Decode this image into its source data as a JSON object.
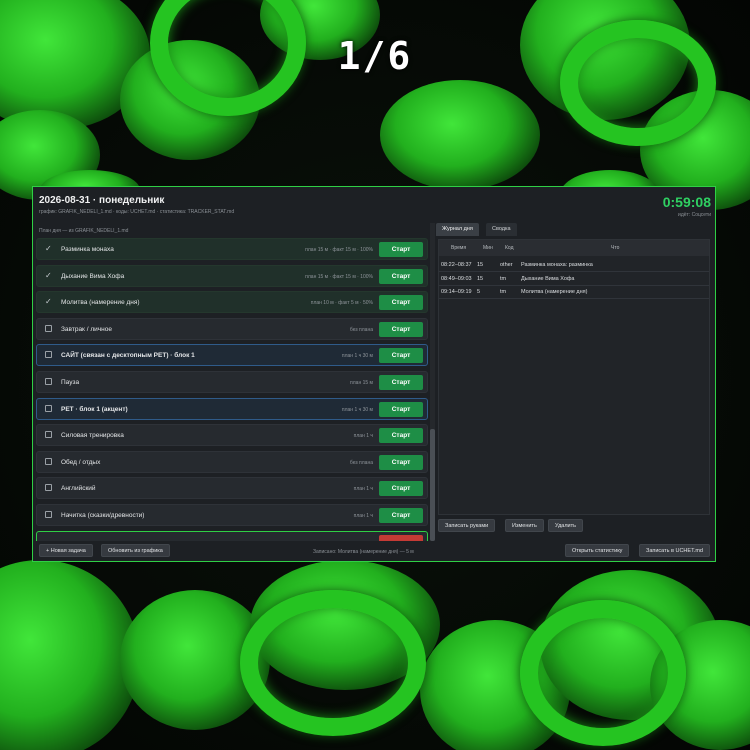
{
  "counter": "1/6",
  "header": {
    "title": "2026-08-31 · понедельник",
    "subtitle": "график: GRAFIK_NEDELI_1.md · коды: UCHET.md · статистика: TRACKER_STAT.md",
    "timer": "0:59:08",
    "timer_sub": "идёт: Соцсети"
  },
  "plan_header": "План дня — из GRAFIK_NEDELI_1.md",
  "tasks": [
    {
      "name": "Разминка монаха",
      "plan": "план 15 м · факт 15 м · 100%",
      "done": true
    },
    {
      "name": "Дыхание Вима Хофа",
      "plan": "план 15 м · факт 15 м · 100%",
      "done": true
    },
    {
      "name": "Молитва (намерение дня)",
      "plan": "план 10 м · факт 5 м · 50%",
      "done": true
    },
    {
      "name": "Завтрак / личное",
      "plan": "без плана",
      "done": false
    },
    {
      "name": "САЙТ (связан с десктопным PET) · блок 1",
      "plan": "план 1 ч 30 м",
      "done": false,
      "accent": true
    },
    {
      "name": "Пауза",
      "plan": "план 15 м",
      "done": false
    },
    {
      "name": "PET · блок 1 (акцент)",
      "plan": "план 1 ч 30 м",
      "done": false,
      "accent": true
    },
    {
      "name": "Силовая тренировка",
      "plan": "план 1 ч",
      "done": false
    },
    {
      "name": "Обед / отдых",
      "plan": "без плана",
      "done": false
    },
    {
      "name": "Английский",
      "plan": "план 1 ч",
      "done": false
    },
    {
      "name": "Начитка (сказки/древности)",
      "plan": "план 1 ч",
      "done": false
    }
  ],
  "start_label": "Старт",
  "left_buttons": {
    "new_task": "+ Новая задача",
    "refresh": "Обновить из графика"
  },
  "status": "Записано: Молитва (намерение дня) — 5 м",
  "right": {
    "tabs": [
      "Журнал дня",
      "Сводка"
    ],
    "active_tab": 0,
    "columns": [
      "Время",
      "Мин",
      "Код",
      "Что"
    ],
    "rows": [
      {
        "time": "08:22–08:37",
        "min": "15",
        "code": "other",
        "what": "Разминка монаха: разминка"
      },
      {
        "time": "08:49–09:03",
        "min": "15",
        "code": "tm",
        "what": "Дыхание Вима Хофа"
      },
      {
        "time": "09:14–09:19",
        "min": "5",
        "code": "tm",
        "what": "Молитва (намерение дня)"
      }
    ],
    "buttons": {
      "manual": "Записать руками",
      "edit": "Изменить",
      "delete": "Удалить"
    },
    "bottom_buttons": {
      "stats": "Открыть статистику",
      "save": "Записать в UCHET.md"
    }
  },
  "colors": {
    "accent_green": "#2fcf45",
    "start_green": "#1e8e46",
    "timer_green": "#2fd062",
    "stop_red": "#c53a35"
  }
}
